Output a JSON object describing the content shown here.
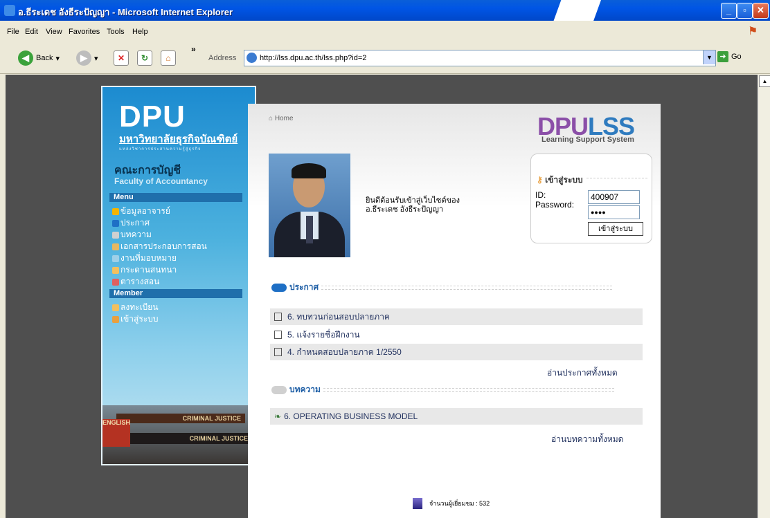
{
  "window": {
    "title": "อ.ธีระเดช อังธีระปัญญา - Microsoft Internet Explorer"
  },
  "menu": {
    "items": [
      "File",
      "Edit",
      "View",
      "Favorites",
      "Tools",
      "Help"
    ]
  },
  "toolbar": {
    "back_label": "Back",
    "address_label": "Address",
    "go_label": "Go",
    "more": "»"
  },
  "address": {
    "url": "http://lss.dpu.ac.th/lss.php?id=2"
  },
  "sidebar": {
    "logo": "DPU",
    "university_th": "มหาวิทยาลัยธุรกิจบัณฑิตย์",
    "university_sub": "แหล่งวิชาการประสานความรู้สู่ธุรกิจ",
    "faculty_th": "คณะการบัญชี",
    "faculty_en": "Faculty of Accountancy",
    "menu_title": "Menu",
    "menu_items": [
      {
        "label": "ข้อมูลอาจารย์",
        "icon": "teacher-icon",
        "color": "#F4B400"
      },
      {
        "label": "ประกาศ",
        "icon": "megaphone-icon",
        "color": "#1E6FC5"
      },
      {
        "label": "บทความ",
        "icon": "article-icon",
        "color": "#D0D0D0"
      },
      {
        "label": "เอกสารประกอบการสอน",
        "icon": "document-icon",
        "color": "#E8B860"
      },
      {
        "label": "งานที่มอบหมาย",
        "icon": "assignment-icon",
        "color": "#9FD0E8"
      },
      {
        "label": "กระดานสนทนา",
        "icon": "forum-icon",
        "color": "#F2C060"
      },
      {
        "label": "ตารางสอน",
        "icon": "schedule-icon",
        "color": "#E06060"
      }
    ],
    "member_title": "Member",
    "member_items": [
      {
        "label": "ลงทะเบียน",
        "icon": "register-icon",
        "color": "#F2C060"
      },
      {
        "label": "เข้าสู่ระบบ",
        "icon": "login-icon",
        "color": "#E8A040"
      }
    ],
    "book_titles": [
      "CRIMINAL JUSTICE",
      "CRIMINAL JUSTICE",
      "ENGLISH"
    ]
  },
  "main": {
    "home_label": "Home",
    "brand_dpu": "DPU",
    "brand_lss": "LSS",
    "brand_sub": "Learning Support System",
    "welcome_line1": "ยินดีต้อนรับเข้าสู่เว็บไซต์ของ",
    "welcome_line2": "อ.ธีระเดช อังธีระปัญญา",
    "login": {
      "title": "เข้าสู่ระบบ",
      "id_label": "ID:",
      "id_value": "400907",
      "password_label": "Password:",
      "password_value": "●●●●",
      "button": "เข้าสู่ระบบ"
    },
    "announce_title": "ประกาศ",
    "announcements": [
      "6. ทบทวนก่อนสอบปลายภาค",
      "5. แจ้งรายชื่อฝึกงาน",
      "4. กำหนดสอบปลายภาค 1/2550"
    ],
    "announce_more": "อ่านประกาศทั้งหมด",
    "article_title": "บทความ",
    "articles": [
      "6. OPERATING BUSINESS MODEL"
    ],
    "article_more": "อ่านบทความทั้งหมด",
    "visitor_text": "จำนวนผู้เยี่ยมชม : 532"
  }
}
